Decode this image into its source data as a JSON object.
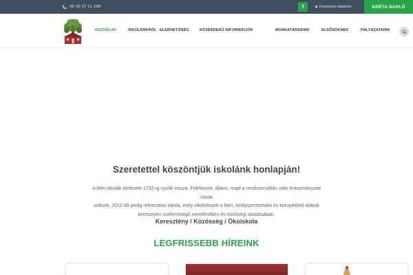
{
  "topbar": {
    "phone": "06 30 27 11 296",
    "facebook_icon_letter": "f",
    "facebook_link": "Facebook-oldalunk",
    "kreta_button": "KRÉTA NAPLÓ",
    "accent_color": "#27a348",
    "bar_color": "#3f4d5e"
  },
  "nav": {
    "items": [
      {
        "label": "KEZDŐLAP",
        "active": true
      },
      {
        "label": "ISKOLÁNKRÓL",
        "active": false
      },
      {
        "label": "ELÉRHETŐSÉG",
        "active": false
      },
      {
        "label": "KÖZÉRDEKŰ INFORMÁCIÓK",
        "active": false
      },
      {
        "label": "MUNKATÁRSAINK",
        "active": false
      },
      {
        "label": "ELSŐSÖKNEK",
        "active": false
      },
      {
        "label": "PÁLYÁZATAINK",
        "active": false
      }
    ],
    "search_icon": "search-icon"
  },
  "welcome": {
    "title": "Szeretettel köszöntjük iskolánk honlapján!",
    "body_lines": [
      "A litéri iskolák története 1732-ig nyúlik vissza. Felekezeti, állami, majd a rendszerváltás után önkormányzati iskola",
      "voltunk, 2012-től pedig református iskola, mely elkötelezett a litéri, királyszentistváni és környékbeli diákok",
      "keresztyén szellemiségű nevelésében és minőségi oktatásában."
    ],
    "motto": "Keresztény / Közösség / Ökoiskola"
  },
  "news": {
    "heading": "LEGFRISSEBB HÍREINK"
  }
}
